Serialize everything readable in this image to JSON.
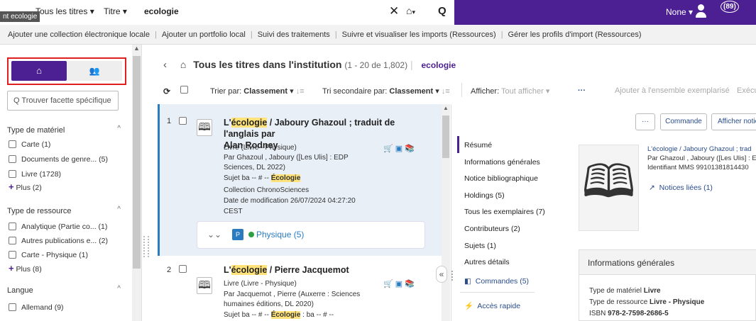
{
  "topbar": {
    "tooltip": "nt ecologie",
    "scope": "Tous les titres",
    "field": "Titre",
    "query": "ecologie",
    "clear_glyph": "✕",
    "search_glyph": "Q",
    "home_glyph": "⌂",
    "dropdown_glyph": "▾",
    "user_label": "None",
    "badge": "(89)"
  },
  "subnav": {
    "items": [
      "Ajouter une collection électronique locale",
      "Ajouter un portfolio local",
      "Suivi des traitements",
      "Suivre et visualiser les imports (Ressources)",
      "Gérer les profils d'import (Ressources)"
    ]
  },
  "facets": {
    "search_placeholder": "Q Trouver facette spécifique",
    "groups": [
      {
        "title": "Type de matériel",
        "items": [
          "Carte (1)",
          "Documents de genre... (5)",
          "Livre (1728)"
        ],
        "more": "Plus (2)"
      },
      {
        "title": "Type de ressource",
        "items": [
          "Analytique (Partie co... (1)",
          "Autres publications e... (2)",
          "Carte - Physique (1)"
        ],
        "more": "Plus (8)"
      },
      {
        "title": "Langue",
        "items": [
          "Allemand (9)"
        ],
        "more": ""
      }
    ]
  },
  "results_header": {
    "back": "‹",
    "title": "Tous les titres dans l'institution",
    "count": "(1 - 20 de 1,802)",
    "keyword": "ecologie"
  },
  "toolbar": {
    "sort_label": "Trier par:",
    "sort_value": "Classement",
    "secondary_label": "Tri secondaire par:",
    "secondary_value": "Classement",
    "show_label": "Afficher:",
    "show_value": "Tout afficher",
    "more": "···",
    "bulk_action": "Ajouter à l'ensemble exemplarisé",
    "execute": "Exécut"
  },
  "results": [
    {
      "num": "1",
      "title_hl": "écologie",
      "title_pre": "L'",
      "title_post": " / Jaboury Ghazoul ; traduit de l'anglais par",
      "title_line2": "Alan Rodney",
      "l1": "Livre (Livre - Physique)",
      "l2": "Par Ghazoul , Jaboury ([Les Ulis] : EDP",
      "l3": "Sciences, DL 2022)",
      "l4_pre": "Sujet ba -- # -- ",
      "l4_hl": "Écologie",
      "l5": "Collection ChronoSciences",
      "l6": "Date de modification 26/07/2024 04:27:20",
      "l7": "CEST",
      "physical": "Physique (5)"
    },
    {
      "num": "2",
      "title_pre": "L'",
      "title_hl": "écologie",
      "title_post": " / Pierre Jacquemot",
      "l1": "Livre (Livre - Physique)",
      "l2": "Par Jacquemot , Pierre (Auxerre : Sciences",
      "l3": "humaines éditions, DL 2020)",
      "l4_pre": "Sujet ba -- # -- ",
      "l4_hl": "Écologie",
      "l4_post": " : ba -- # --"
    }
  ],
  "detail": {
    "buttons": [
      "···",
      "Commande",
      "Afficher notice"
    ],
    "nav": [
      "Résumé",
      "Informations générales",
      "Notice bibliographique",
      "Holdings (5)",
      "Tous les exemplaires (7)",
      "Contributeurs (2)",
      "Sujets (1)",
      "Autres détails",
      "Commandes (5)",
      "Accès rapide"
    ],
    "citation_title": "L'écologie / Jaboury Ghazoul ; trad",
    "citation_author": "Par Ghazoul , Jaboury ([Les Ulis] : E",
    "citation_mms": "Identifiant MMS 99101381814430",
    "linked": "Notices liées (1)",
    "info_title": "Informations générales",
    "info_rows": [
      {
        "label": "Type de matériel",
        "value": "Livre"
      },
      {
        "label": "Type de ressource",
        "value": "Livre - Physique"
      },
      {
        "label": "ISBN",
        "value": "978-2-7598-2686-5"
      }
    ]
  }
}
